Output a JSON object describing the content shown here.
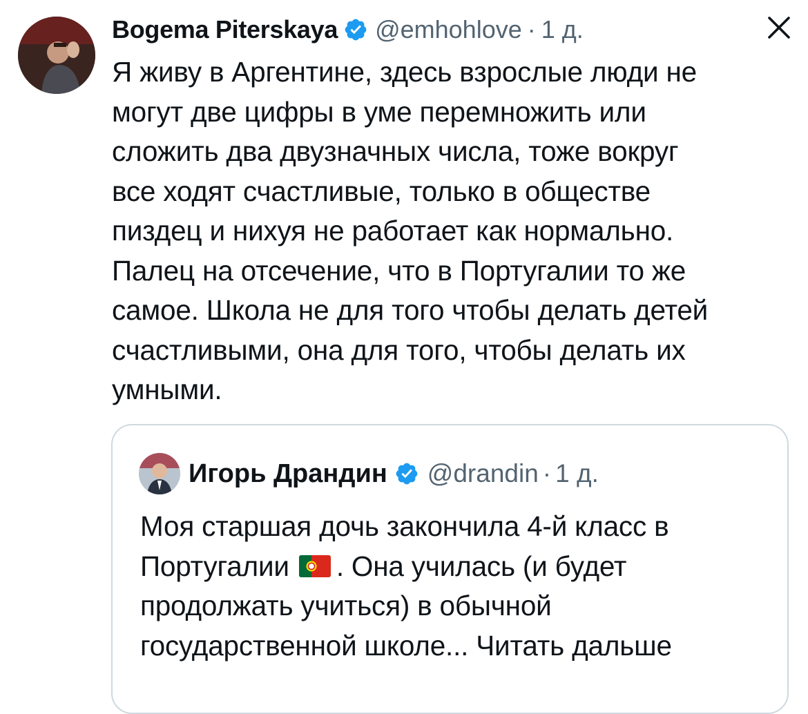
{
  "tweet": {
    "author_name": "Bogema Piterskaya",
    "handle": "@emhohlove",
    "separator": "·",
    "time": "1 д.",
    "text": "Я живу в Аргентине, здесь взрослые люди не\nмогут две цифры в уме перемножить или\nсложить два двузначных числа, тоже вокруг\nвсе ходят счастливые, только в обществе\nпиздец и нихуя не работает как нормально.\nПалец на отсечение, что в Португалии то же\nсамое. Школа не для того чтобы делать детей\nсчастливыми, она для того, чтобы делать их\nумными."
  },
  "quote": {
    "author_name": "Игорь Драндин",
    "handle": "@drandin",
    "separator": "·",
    "time": "1 д.",
    "text_before_flag": "Моя старшая дочь закончила 4-й класс в Португалии",
    "text_after_flag": ". Она училась (и будет продолжать учиться) в обычной государственной школе...",
    "read_more": "Читать дальше"
  },
  "icons": {
    "verified": "verified-badge-icon",
    "close": "close-icon",
    "flag": "portugal-flag-icon"
  },
  "colors": {
    "verified_blue": "#1d9bf0",
    "secondary_text": "#536471",
    "primary_text": "#0f1419",
    "border": "#cfd9de"
  }
}
